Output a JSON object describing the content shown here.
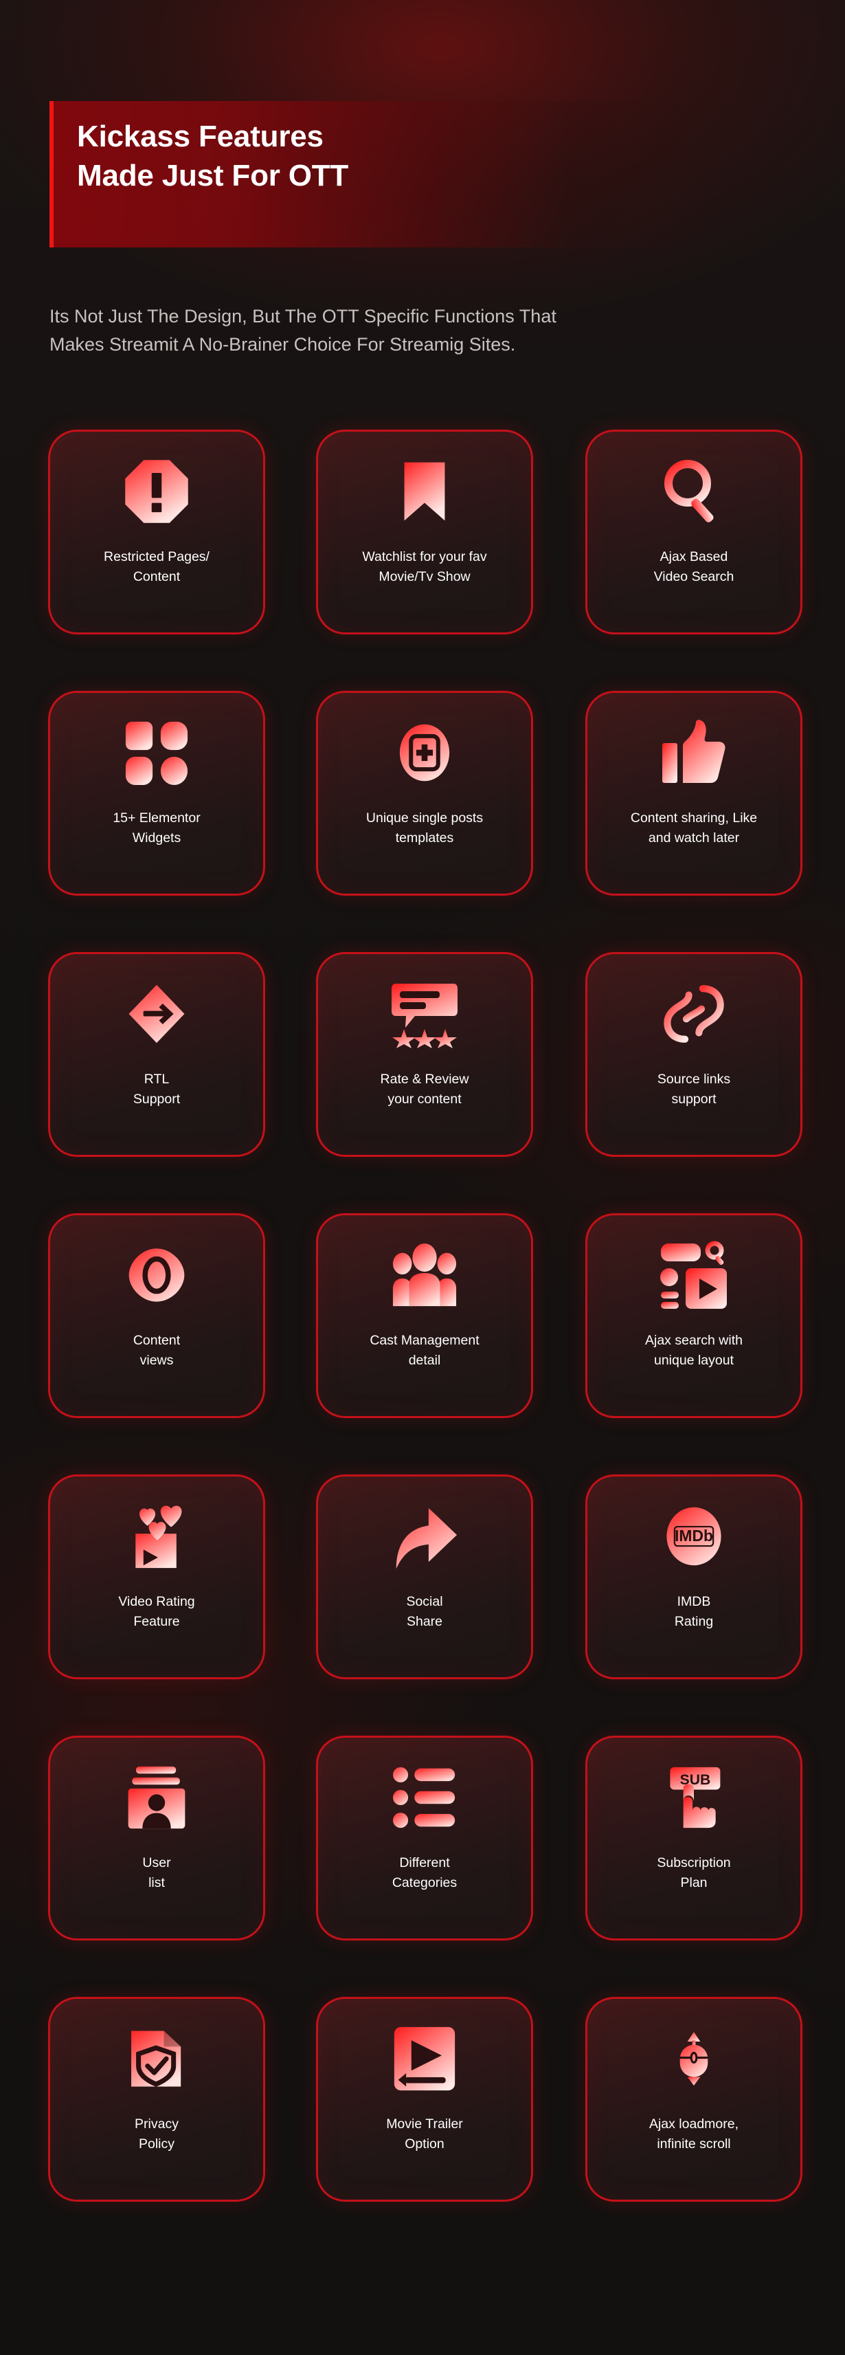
{
  "header": {
    "title": "Kickass Features\nMade Just For OTT",
    "subtitle": "Its Not Just The Design, But The OTT Specific Functions That\nMakes Streamit A No-Brainer Choice For Streamig Sites."
  },
  "colors": {
    "page_background": "#141110",
    "banner_red": "#830810",
    "accent_bar": "#f01414",
    "card_border": "#c41119",
    "icon_gradient_start": "#ff2020",
    "icon_gradient_end": "#ffe3e0",
    "label_text": "#ffffff",
    "subtitle_text": "#c8c1c0"
  },
  "features": [
    {
      "label": "Restricted Pages/\nContent",
      "icon": "octagon-exclamation-icon"
    },
    {
      "label": "Watchlist for your fav\nMovie/Tv Show",
      "icon": "bookmark-icon"
    },
    {
      "label": "Ajax Based\nVideo Search",
      "icon": "magnifier-search-icon"
    },
    {
      "label": "15+ Elementor\nWidgets",
      "icon": "four-blocks-widgets-icon"
    },
    {
      "label": "Unique single posts\ntemplates",
      "icon": "oval-plus-post-icon"
    },
    {
      "label": "Content sharing, Like\nand watch later",
      "icon": "thumbs-up-icon"
    },
    {
      "label": "RTL\nSupport",
      "icon": "diamond-arrow-rtl-icon"
    },
    {
      "label": "Rate & Review\nyour content",
      "icon": "comment-stars-rating-icon"
    },
    {
      "label": "Source links\nsupport",
      "icon": "chain-link-icon"
    },
    {
      "label": "Content\nviews",
      "icon": "eye-views-icon"
    },
    {
      "label": "Cast Management\ndetail",
      "icon": "people-group-icon"
    },
    {
      "label": "Ajax search with\nunique layout",
      "icon": "search-layout-play-icon"
    },
    {
      "label": "Video Rating\nFeature",
      "icon": "hearts-video-rating-icon"
    },
    {
      "label": "Social\nShare",
      "icon": "curved-share-arrow-icon"
    },
    {
      "label": "IMDB\nRating",
      "icon": "imdb-circle-icon",
      "badge_text": "IMDb"
    },
    {
      "label": "User\nlist",
      "icon": "user-card-list-icon"
    },
    {
      "label": "Different\nCategories",
      "icon": "bullet-list-categories-icon"
    },
    {
      "label": "Subscription\nPlan",
      "icon": "sub-button-hand-icon",
      "badge_text": "SUB"
    },
    {
      "label": "Privacy\nPolicy",
      "icon": "document-shield-check-icon"
    },
    {
      "label": "Movie Trailer\nOption",
      "icon": "trailer-play-slider-icon"
    },
    {
      "label": "Ajax loadmore,\ninfinite scroll",
      "icon": "mouse-scroll-icon"
    }
  ]
}
